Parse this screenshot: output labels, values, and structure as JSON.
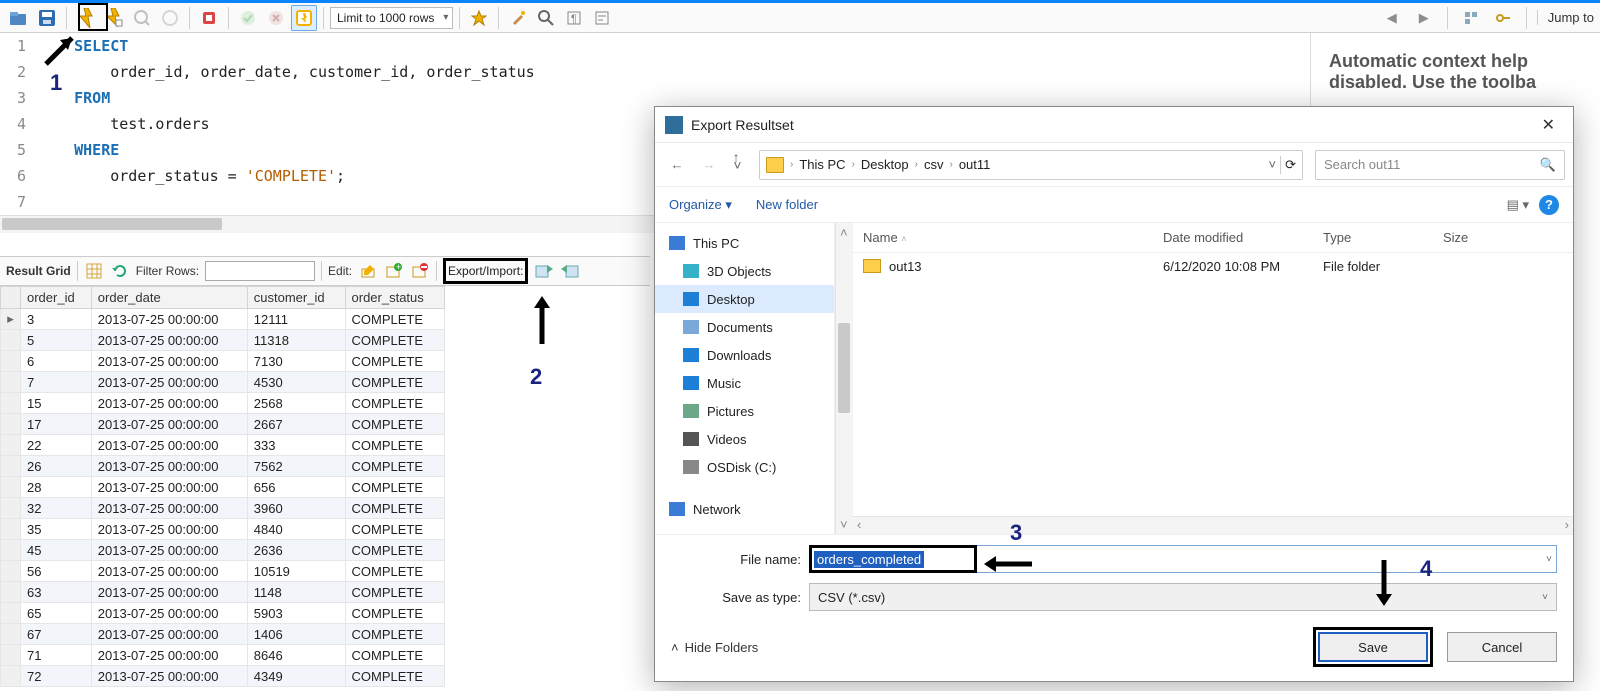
{
  "toolbar": {
    "limit_label": "Limit to 1000 rows",
    "jump_label": "Jump to"
  },
  "sql": [
    {
      "n": "1",
      "pre": "    ",
      "kw": "SELECT",
      "rest": ""
    },
    {
      "n": "2",
      "pre": "        ",
      "kw": "",
      "rest": "order_id, order_date, customer_id, order_status"
    },
    {
      "n": "3",
      "pre": "    ",
      "kw": "FROM",
      "rest": ""
    },
    {
      "n": "4",
      "pre": "        ",
      "kw": "",
      "rest": "test.orders"
    },
    {
      "n": "5",
      "pre": "    ",
      "kw": "WHERE",
      "rest": ""
    },
    {
      "n": "6",
      "pre": "        ",
      "kw": "",
      "rest": "order_status = ",
      "str": "'COMPLETE'",
      "tail": ";"
    },
    {
      "n": "7",
      "pre": "",
      "kw": "",
      "rest": ""
    }
  ],
  "gridbar": {
    "result_grid": "Result Grid",
    "filter_label": "Filter Rows:",
    "edit_label": "Edit:",
    "export_label": "Export/Import:"
  },
  "columns": [
    "order_id",
    "order_date",
    "customer_id",
    "order_status"
  ],
  "rows": [
    [
      "3",
      "2013-07-25 00:00:00",
      "12111",
      "COMPLETE"
    ],
    [
      "5",
      "2013-07-25 00:00:00",
      "11318",
      "COMPLETE"
    ],
    [
      "6",
      "2013-07-25 00:00:00",
      "7130",
      "COMPLETE"
    ],
    [
      "7",
      "2013-07-25 00:00:00",
      "4530",
      "COMPLETE"
    ],
    [
      "15",
      "2013-07-25 00:00:00",
      "2568",
      "COMPLETE"
    ],
    [
      "17",
      "2013-07-25 00:00:00",
      "2667",
      "COMPLETE"
    ],
    [
      "22",
      "2013-07-25 00:00:00",
      "333",
      "COMPLETE"
    ],
    [
      "26",
      "2013-07-25 00:00:00",
      "7562",
      "COMPLETE"
    ],
    [
      "28",
      "2013-07-25 00:00:00",
      "656",
      "COMPLETE"
    ],
    [
      "32",
      "2013-07-25 00:00:00",
      "3960",
      "COMPLETE"
    ],
    [
      "35",
      "2013-07-25 00:00:00",
      "4840",
      "COMPLETE"
    ],
    [
      "45",
      "2013-07-25 00:00:00",
      "2636",
      "COMPLETE"
    ],
    [
      "56",
      "2013-07-25 00:00:00",
      "10519",
      "COMPLETE"
    ],
    [
      "63",
      "2013-07-25 00:00:00",
      "1148",
      "COMPLETE"
    ],
    [
      "65",
      "2013-07-25 00:00:00",
      "5903",
      "COMPLETE"
    ],
    [
      "67",
      "2013-07-25 00:00:00",
      "1406",
      "COMPLETE"
    ],
    [
      "71",
      "2013-07-25 00:00:00",
      "8646",
      "COMPLETE"
    ],
    [
      "72",
      "2013-07-25 00:00:00",
      "4349",
      "COMPLETE"
    ]
  ],
  "help": {
    "line1": "Automatic context help",
    "line2": "disabled. Use the toolba"
  },
  "dialog": {
    "title": "Export Resultset",
    "breadcrumb": [
      "This PC",
      "Desktop",
      "csv",
      "out11"
    ],
    "search_placeholder": "Search out11",
    "organize": "Organize",
    "newfolder": "New folder",
    "tree": [
      {
        "label": "This PC",
        "cls": "hdr",
        "color": "#3a7bd5"
      },
      {
        "label": "3D Objects",
        "color": "#35b1c9"
      },
      {
        "label": "Desktop",
        "sel": true,
        "color": "#1e7fd6"
      },
      {
        "label": "Documents",
        "color": "#7aa8d8"
      },
      {
        "label": "Downloads",
        "color": "#1e7fd6"
      },
      {
        "label": "Music",
        "color": "#1e7fd6"
      },
      {
        "label": "Pictures",
        "color": "#6aa888"
      },
      {
        "label": "Videos",
        "color": "#555"
      },
      {
        "label": "OSDisk (C:)",
        "color": "#888"
      },
      {
        "label": "Network",
        "cls": "hdr",
        "color": "#3a7bd5",
        "gap": true
      }
    ],
    "file_cols": {
      "name": "Name",
      "date": "Date modified",
      "type": "Type",
      "size": "Size"
    },
    "file_rows": [
      {
        "name": "out13",
        "date": "6/12/2020 10:08 PM",
        "type": "File folder",
        "size": ""
      }
    ],
    "fname_label": "File name:",
    "fname_value": "orders_completed",
    "ftype_label": "Save as type:",
    "ftype_value": "CSV (*.csv)",
    "hide": "Hide Folders",
    "save": "Save",
    "cancel": "Cancel"
  },
  "annotations": {
    "n1": "1",
    "n2": "2",
    "n3": "3",
    "n4": "4"
  }
}
